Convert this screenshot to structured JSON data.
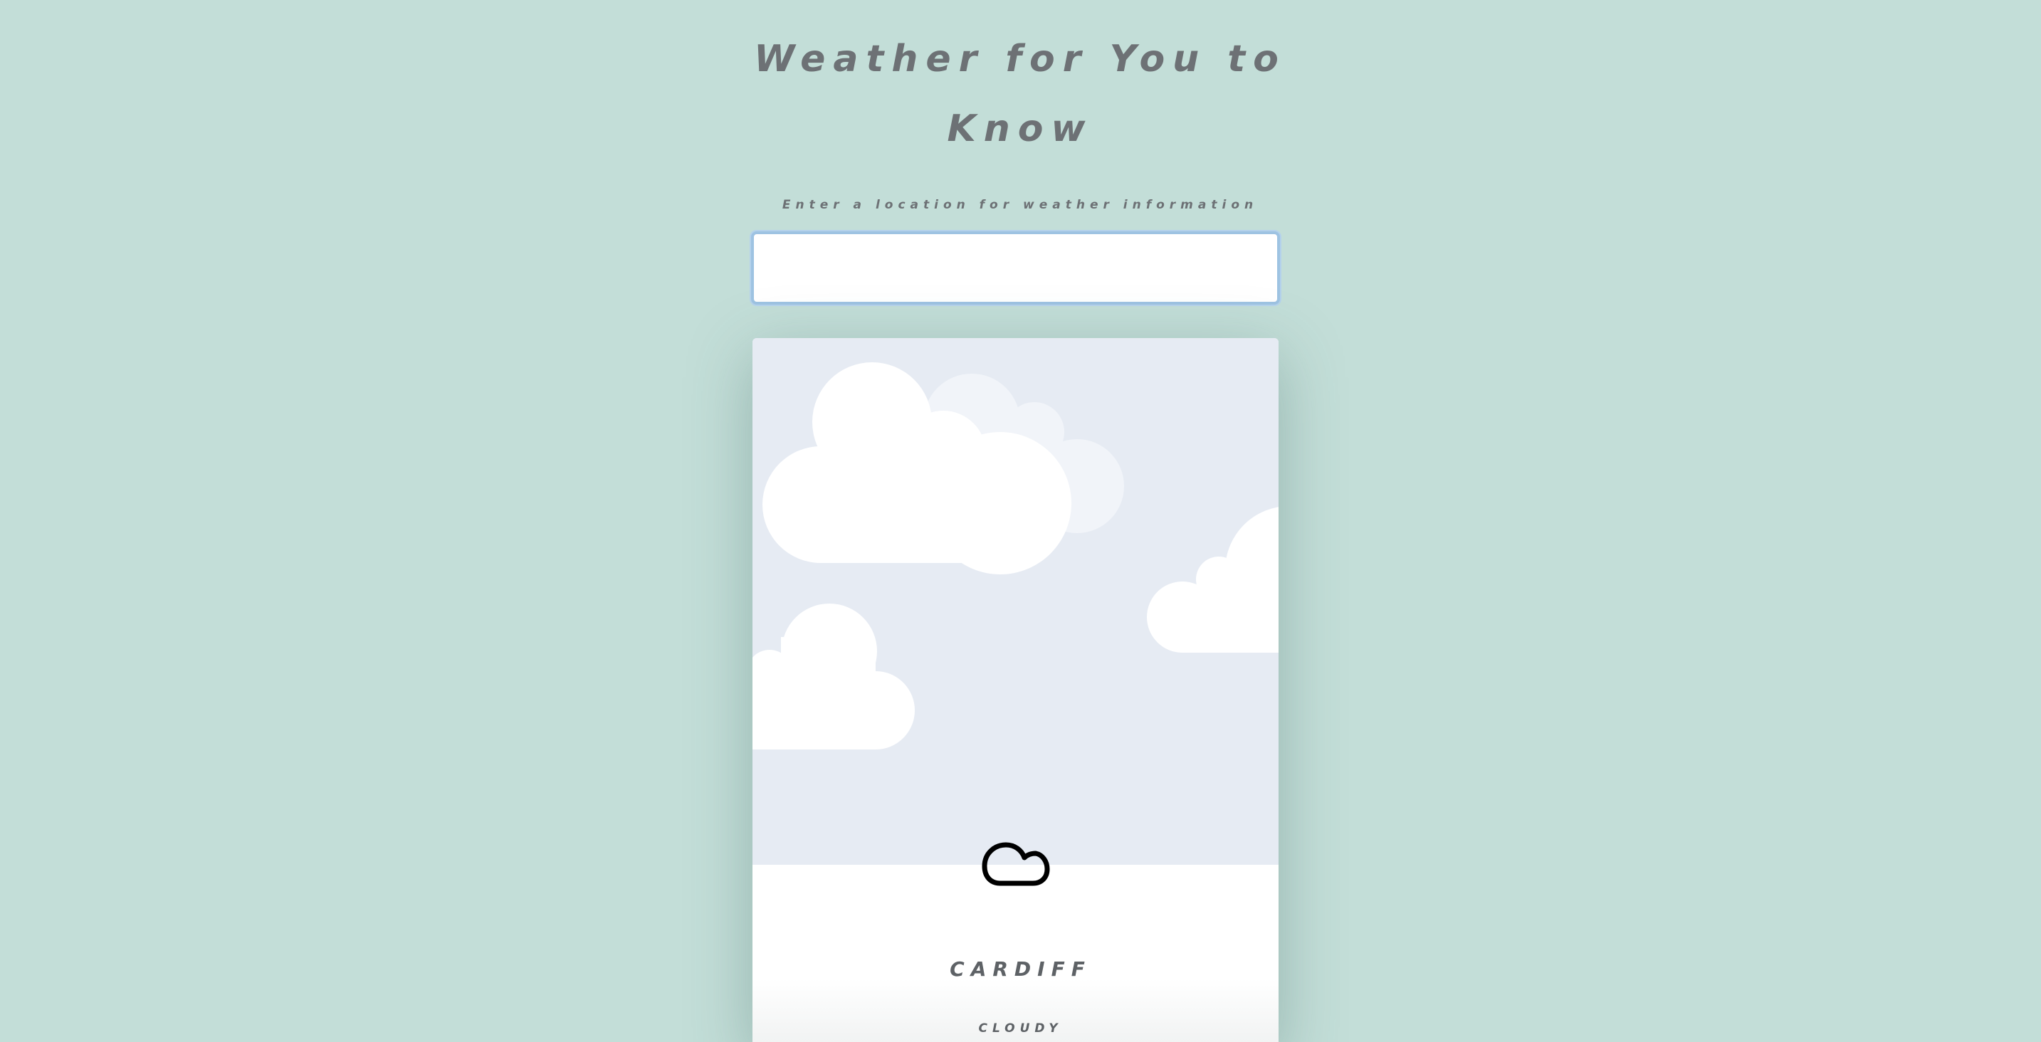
{
  "header": {
    "title_line1": "Weather for You to",
    "title_line2": "Know"
  },
  "search": {
    "prompt": "Enter a location for weather information",
    "value": "",
    "placeholder": ""
  },
  "weather_card": {
    "icon": "cloud-icon",
    "city": "CARDIFF",
    "condition": "CLOUDY"
  },
  "colors": {
    "background": "#c3ded8",
    "text": "#6d7175",
    "sky": "#e6ebf3",
    "input_focus_border": "#9ec3e2"
  }
}
